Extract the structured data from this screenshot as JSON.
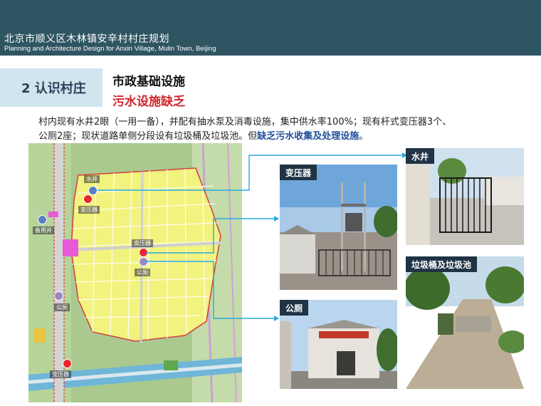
{
  "header": {
    "title": "北京市顺义区木林镇安辛村村庄规划",
    "subtitle": "Planning and Architecture Design for Anxin Village, Mulin Town, Beijing"
  },
  "section": {
    "tab": "2  认识村庄",
    "heading": "市政基础设施",
    "subheading": "污水设施缺乏"
  },
  "description": {
    "line1": "村内现有水井2眼（一用一备），并配有抽水泵及消毒设施，集中供水率100%；现有杆式变压器3个、",
    "line2_plain": "公厕2座；现状道路单侧分段设有垃圾桶及垃圾池。但",
    "line2_highlight": "缺乏污水收集及处理设施",
    "line2_end": "。"
  },
  "map_markers": {
    "well": "水井",
    "transformer_top": "变压器",
    "backup_well": "备用井",
    "transformer_mid": "变压器",
    "toilet_mid": "公厕",
    "toilet_left": "公厕",
    "transformer_bottom": "变压器"
  },
  "photos": {
    "transformer": "变压器",
    "well": "水井",
    "toilet": "公厕",
    "garbage": "垃圾桶及垃圾池"
  },
  "colors": {
    "header_bg": "#2f5563",
    "tab_bg": "#cfe6ef",
    "highlight_red": "#d2262b",
    "highlight_blue": "#1f4e9a",
    "marker_red": "#e8262d",
    "marker_blue": "#5b7fc4",
    "marker_purple": "#9c87c2",
    "connector": "#2aa7e0"
  }
}
